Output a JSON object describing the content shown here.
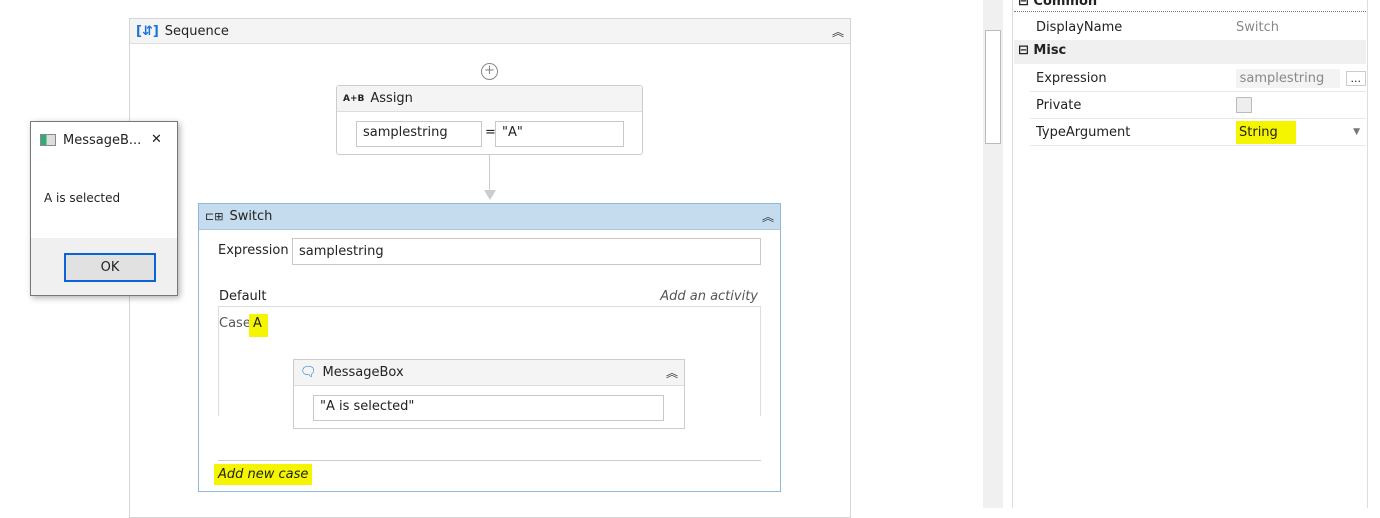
{
  "sequence": {
    "title": "Sequence"
  },
  "assign": {
    "title": "Assign",
    "icon_text": "A+B",
    "to": "samplestring",
    "eq": "=",
    "value": "\"A\""
  },
  "switch": {
    "title": "Switch",
    "expression_label": "Expression",
    "expression": "samplestring",
    "default_label": "Default",
    "add_activity": "Add an activity",
    "case_label": "Case",
    "case_value": "A",
    "add_case": "Add new case"
  },
  "messagebox_activity": {
    "title": "MessageBox",
    "text": "\"A is selected\""
  },
  "dialog": {
    "title": "MessageB...",
    "message": "A is selected",
    "ok": "OK",
    "close": "✕"
  },
  "properties": {
    "common_label": "Common",
    "displayname_label": "DisplayName",
    "displayname": "Switch",
    "misc_label": "Misc",
    "expression_label": "Expression",
    "expression": "samplestring",
    "ellipsis": "...",
    "private_label": "Private",
    "typearg_label": "TypeArgument",
    "typearg": "String"
  }
}
